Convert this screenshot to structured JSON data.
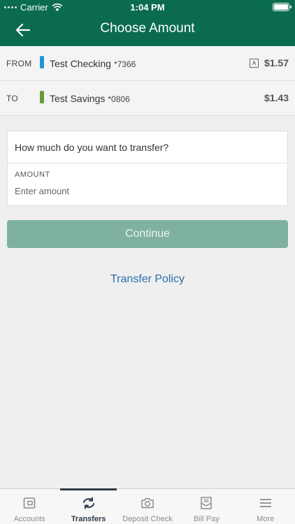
{
  "status_bar": {
    "carrier": "Carrier",
    "time": "1:04 PM"
  },
  "header": {
    "title": "Choose Amount",
    "back_icon": "back-arrow-icon"
  },
  "from": {
    "label": "FROM",
    "account_name": "Test Checking",
    "account_number": "*7366",
    "badge": "A",
    "amount": "$1.57",
    "color": "#2196d3"
  },
  "to": {
    "label": "TO",
    "account_name": "Test Savings",
    "account_number": "*0806",
    "amount": "$1.43",
    "color": "#6a9a3a"
  },
  "form": {
    "question": "How much do you want to transfer?",
    "amount_label": "AMOUNT",
    "amount_placeholder": "Enter amount",
    "amount_value": ""
  },
  "continue_label": "Continue",
  "policy_link": "Transfer Policy",
  "tabs": [
    {
      "label": "Accounts",
      "icon": "wallet-icon"
    },
    {
      "label": "Transfers",
      "icon": "transfer-arrows-icon"
    },
    {
      "label": "Deposit Check",
      "icon": "camera-icon"
    },
    {
      "label": "Bill Pay",
      "icon": "bill-icon"
    },
    {
      "label": "More",
      "icon": "menu-icon"
    }
  ],
  "active_tab": "Transfers",
  "colors": {
    "brand": "#0b6b4f",
    "button": "#7fb1a0",
    "link": "#2a6ea8"
  }
}
